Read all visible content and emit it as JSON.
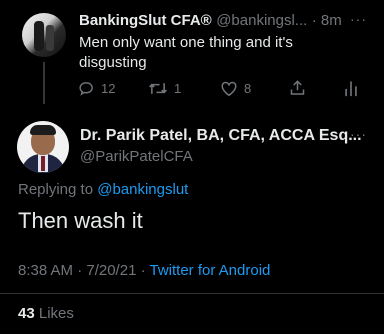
{
  "tweet1": {
    "display_name": "BankingSlut CFA®",
    "handle": "@bankingsl...",
    "time": "· 8m",
    "text_line1": "Men only want one thing and it's",
    "text_line2": "disgusting",
    "replies": "12",
    "retweets": "1",
    "likes": "8",
    "icons": [
      "reply-icon",
      "retweet-icon",
      "like-icon",
      "share-icon",
      "analytics-icon"
    ]
  },
  "tweet2": {
    "display_name": "Dr. Parik Patel, BA, CFA, ACCA Esq...",
    "handle": "@ParikPatelCFA",
    "replying_prefix": "Replying to",
    "replying_to": "@bankingslut",
    "text": "Then wash it",
    "timestamp": "8:38 AM · 7/20/21 ·",
    "source": "Twitter for Android",
    "likes_count": "43",
    "likes_label": "Likes"
  },
  "more_label": "···",
  "colors": {
    "background": "#000000",
    "primary_text": "#e7e9ea",
    "secondary_text": "#71767b",
    "accent": "#1d9bf0"
  }
}
